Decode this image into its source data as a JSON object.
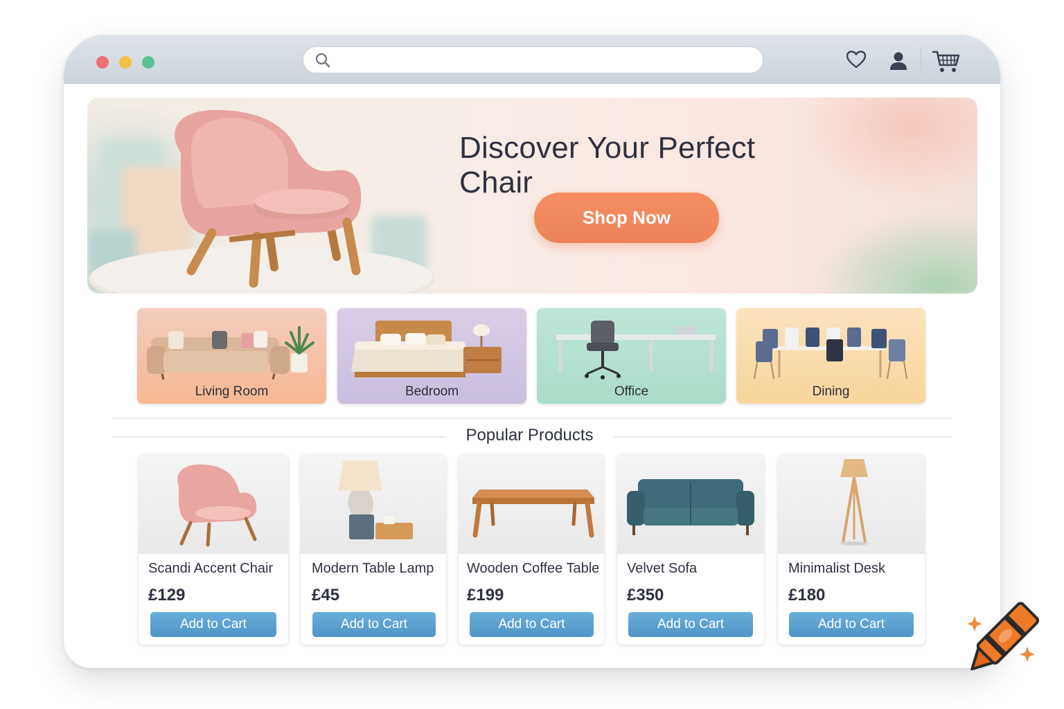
{
  "browser": {
    "search_placeholder": "",
    "icons": [
      "search-icon",
      "heart-icon",
      "user-icon",
      "cart-icon"
    ]
  },
  "hero": {
    "title": "Discover Your Perfect Chair",
    "cta_label": "Shop Now"
  },
  "categories": [
    {
      "label": "Living Room"
    },
    {
      "label": "Bedroom"
    },
    {
      "label": "Office"
    },
    {
      "label": "Dining"
    }
  ],
  "popular": {
    "title": "Popular Products",
    "products": [
      {
        "name": "Scandi Accent Chair",
        "price": "£129",
        "button": "Add to Cart"
      },
      {
        "name": "Modern Table Lamp",
        "price": "£45",
        "button": "Add to Cart"
      },
      {
        "name": "Wooden Coffee Table",
        "price": "£199",
        "button": "Add to Cart"
      },
      {
        "name": "Velvet Sofa",
        "price": "£350",
        "button": "Add to Cart"
      },
      {
        "name": "Minimalist Desk",
        "price": "£180",
        "button": "Add to Cart"
      }
    ]
  },
  "colors": {
    "accent_orange": "#ee8258",
    "button_blue": "#5aa0cf",
    "titlebar": "#d5dbe2"
  }
}
